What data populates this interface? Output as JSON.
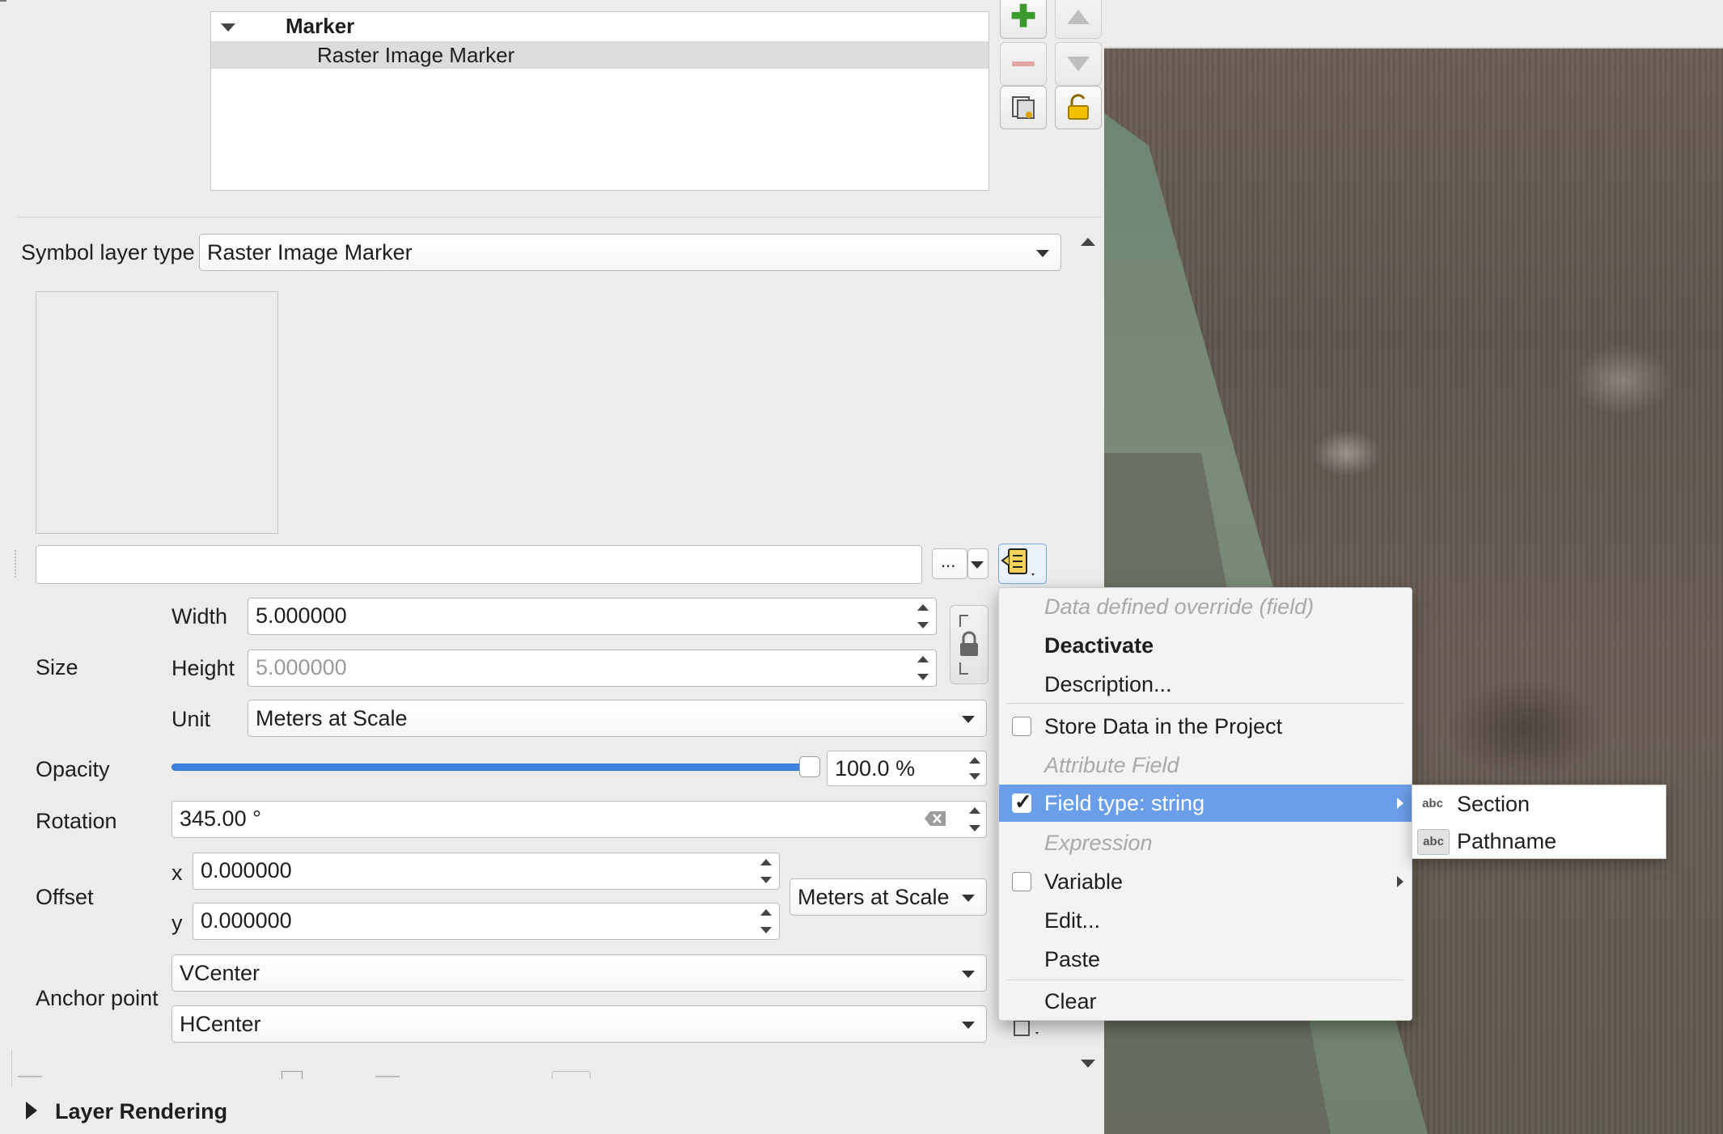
{
  "tree": {
    "root": "Marker",
    "child": "Raster Image Marker"
  },
  "symbol_layer": {
    "label": "Symbol layer type",
    "value": "Raster Image Marker"
  },
  "path": {
    "value": "",
    "browse_label": "..."
  },
  "size": {
    "label": "Size",
    "width_label": "Width",
    "width_value": "5.000000",
    "height_label": "Height",
    "height_value": "5.000000",
    "unit_label": "Unit",
    "unit_value": "Meters at Scale"
  },
  "opacity": {
    "label": "Opacity",
    "value": "100.0 %",
    "level": 1.0
  },
  "rotation": {
    "label": "Rotation",
    "value": "345.00 °"
  },
  "offset": {
    "label": "Offset",
    "x_label": "x",
    "x_value": "0.000000",
    "y_label": "y",
    "y_value": "0.000000",
    "unit_value": "Meters at Scale"
  },
  "anchor": {
    "label": "Anchor point",
    "vertical": "VCenter",
    "horizontal": "HCenter"
  },
  "layer_rendering": "Layer Rendering",
  "menu": {
    "header": "Data defined override (field)",
    "deactivate": "Deactivate",
    "description": "Description...",
    "store_data": "Store Data in the Project",
    "attribute_field": "Attribute Field",
    "field_type": "Field type: string",
    "expression": "Expression",
    "variable": "Variable",
    "edit": "Edit...",
    "paste": "Paste",
    "clear": "Clear"
  },
  "submenu": {
    "items": [
      {
        "icon": "abc",
        "label": "Section"
      },
      {
        "icon": "abc",
        "label": "Pathname"
      }
    ]
  },
  "colors": {
    "menu_highlight": "#6b9ee9",
    "slider": "#3f83e2"
  }
}
